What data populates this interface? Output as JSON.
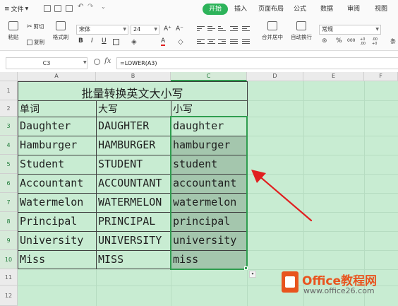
{
  "menu": {
    "file_label": "文件",
    "tabs": [
      {
        "label": "开始",
        "active": true
      },
      {
        "label": "插入"
      },
      {
        "label": "页面布局"
      },
      {
        "label": "公式"
      },
      {
        "label": "数据"
      },
      {
        "label": "审阅"
      },
      {
        "label": "视图"
      }
    ]
  },
  "ribbon": {
    "paste": "粘贴",
    "cut": "剪切",
    "copy": "复制",
    "format_painter": "格式刷",
    "font_name": "宋体",
    "font_size": "24",
    "bold": "B",
    "italic": "I",
    "underline": "U",
    "font_grow": "A⁺",
    "font_shrink": "A⁻",
    "font_color": "A",
    "merge_center": "合并居中",
    "wrap_text": "自动换行",
    "number_format": "常规",
    "percent": "%",
    "thousands": "000",
    "inc_decimal": "+0 .00",
    "dec_decimal": ".00 +0",
    "extra": "条"
  },
  "formula_bar": {
    "name_box": "C3",
    "fx": "fx",
    "formula": "=LOWER(A3)"
  },
  "sheet": {
    "columns": [
      "A",
      "B",
      "C",
      "D",
      "E",
      "F"
    ],
    "rows": [
      "1",
      "2",
      "3",
      "4",
      "5",
      "6",
      "7",
      "8",
      "9",
      "10",
      "11",
      "12"
    ],
    "title": "批量转换英文大小写",
    "headers": [
      "单词",
      "大写",
      "小写"
    ],
    "data": [
      [
        "Daughter",
        "DAUGHTER",
        "daughter"
      ],
      [
        "Hamburger",
        "HAMBURGER",
        "hamburger"
      ],
      [
        "Student",
        "STUDENT",
        "student"
      ],
      [
        "Accountant",
        "ACCOUNTANT",
        "accountant"
      ],
      [
        "Watermelon",
        "WATERMELON",
        "watermelon"
      ],
      [
        "Principal",
        "PRINCIPAL",
        "principal"
      ],
      [
        "University",
        "UNIVERSITY",
        "university"
      ],
      [
        "Miss",
        "MISS",
        "miss"
      ]
    ],
    "selected_cell": "C3",
    "selection_range": "C3:C10"
  },
  "watermark": {
    "title": "Office教程网",
    "url": "www.office26.com"
  },
  "colors": {
    "accent": "#2db35a",
    "sheet_bg": "#c8ecd2",
    "selection": "#a4c6ad",
    "arrow": "#e02020",
    "watermark": "#e8541e"
  }
}
